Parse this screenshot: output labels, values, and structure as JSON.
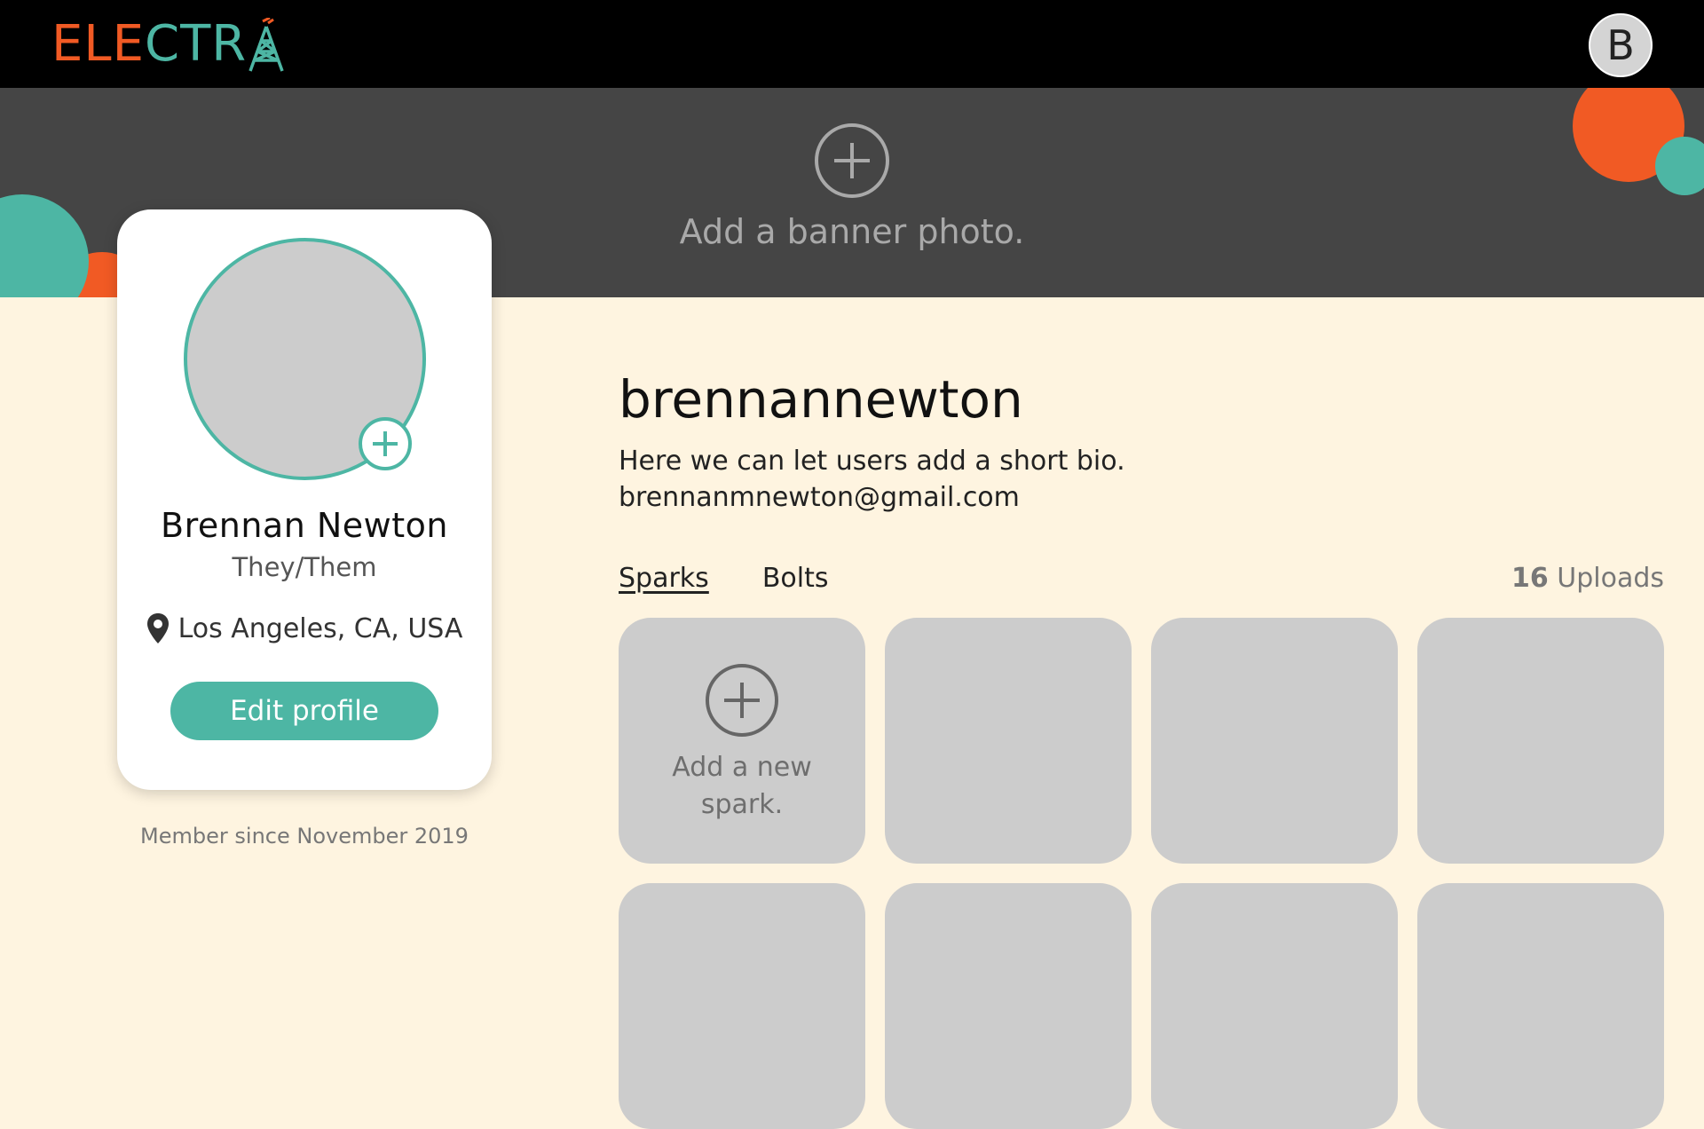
{
  "colors": {
    "brand_orange": "#F15A24",
    "brand_teal": "#4DB6A4",
    "banner_bg": "#454545",
    "page_bg": "#FEF4E0"
  },
  "header": {
    "logo_parts": [
      "ELE",
      "CTR"
    ],
    "logo_tower_icon": "radio-tower-icon",
    "user_initial": "B"
  },
  "banner": {
    "add_label": "Add a banner photo.",
    "add_icon": "plus-circle-icon"
  },
  "profile": {
    "full_name": "Brennan Newton",
    "pronouns": "They/Them",
    "location": "Los Angeles, CA, USA",
    "location_icon": "map-pin-icon",
    "edit_button": "Edit profile",
    "member_since": "Member since November 2019",
    "avatar_add_icon": "plus-icon"
  },
  "main": {
    "username": "brennannewton",
    "bio": "Here we can let users add a short bio.",
    "email": "brennanmnewton@gmail.com",
    "tabs": [
      {
        "label": "Sparks",
        "active": true
      },
      {
        "label": "Bolts",
        "active": false
      }
    ],
    "uploads_count": "16",
    "uploads_label": "Uploads",
    "add_spark_label": "Add a new spark."
  }
}
